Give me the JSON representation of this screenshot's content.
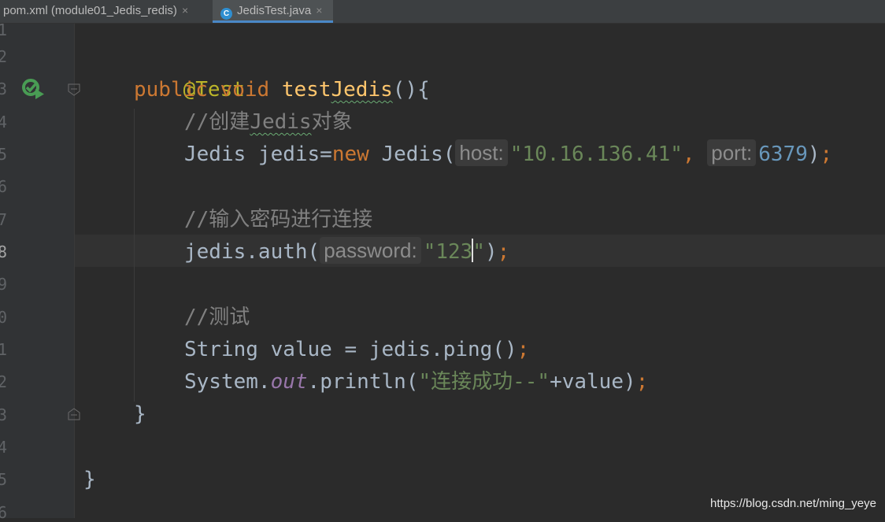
{
  "tabs": [
    {
      "label": "pom.xml (module01_Jedis_redis)",
      "close": "×",
      "active": false
    },
    {
      "label": "JedisTest.java",
      "icon": "C",
      "close": "×",
      "active": true
    }
  ],
  "line_numbers": [
    "1",
    "2",
    "3",
    "4",
    "5",
    "6",
    "7",
    "8",
    "9",
    "0",
    "1",
    "2",
    "3",
    "4",
    "5",
    "6"
  ],
  "code": {
    "l2": {
      "annotation": "@Test"
    },
    "l3": {
      "kw_public": "public",
      "kw_void": "void",
      "name_a": "test",
      "name_b": "Jedis",
      "tail": "(){"
    },
    "l4": {
      "c1": "//创建",
      "c2": "Jedis",
      "c3": "对象"
    },
    "l5": {
      "a": "Jedis jedis=",
      "kw_new": "new",
      "b": " Jedis(",
      "hint_host": "host:",
      "host": "\"10.16.136.41\"",
      "comma": ",",
      "hint_port": "port:",
      "port": "6379",
      "close": ")",
      "semi": ";"
    },
    "l7": {
      "comment": "//输入密码进行连接"
    },
    "l8": {
      "a": "jedis.auth(",
      "hint_password": "password:",
      "pw_a": "\"123",
      "pw_b": "\"",
      "close": ")",
      "semi": ";"
    },
    "l10": {
      "comment": "//测试"
    },
    "l11": {
      "a": "String value = jedis.ping()",
      "semi": ";"
    },
    "l12": {
      "a": "System.",
      "field": "out",
      "b": ".println(",
      "str": "\"连接成功--\"",
      "c": "+value)",
      "semi": ";"
    },
    "l13": {
      "brace": "}"
    },
    "l15": {
      "brace": "}"
    }
  },
  "watermark": "https://blog.csdn.net/ming_yeye",
  "colors": {
    "keyword": "#cc7832",
    "string": "#6a8759",
    "number": "#6897bb",
    "comment": "#808080",
    "method": "#ffc66d",
    "annotation": "#bbb529",
    "active_tab_underline": "#4a88c7"
  },
  "icons": [
    "java-class-icon",
    "close-icon",
    "run-test-icon",
    "lightbulb-icon",
    "fold-icon"
  ]
}
